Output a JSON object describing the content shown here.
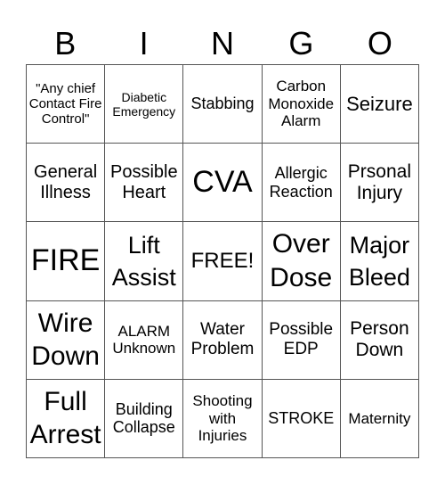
{
  "header": [
    "B",
    "I",
    "N",
    "G",
    "O"
  ],
  "cells": [
    "\"Any chief Contact Fire Control\"",
    "Diabetic Emergency",
    "Stabbing",
    "Carbon Monoxide Alarm",
    "Seizure",
    "General Illness",
    "Possible Heart",
    "CVA",
    "Allergic Reaction",
    "Prsonal Injury",
    "FIRE",
    "Lift Assist",
    "FREE!",
    "Over Dose",
    "Major Bleed",
    "Wire Down",
    "ALARM Unknown",
    "Water Problem",
    "Possible EDP",
    "Person Down",
    "Full Arrest",
    "Building Collapse",
    "Shooting with Injuries",
    "STROKE",
    "Maternity"
  ]
}
